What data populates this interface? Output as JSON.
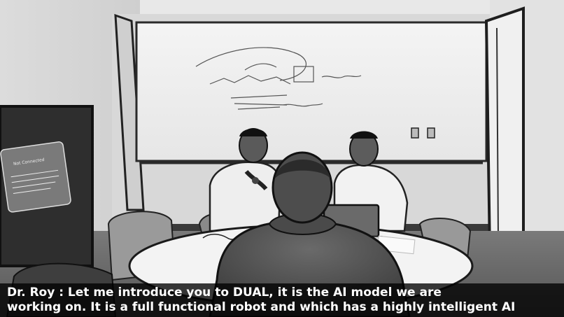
{
  "caption": {
    "line1": "Dr. Roy : Let me introduce you to DUAL, it is the AI model we are",
    "line2": "working on. It is a full functional robot and which has a highly intelligent AI"
  },
  "tv_screen": {
    "title": "Not Connected",
    "body": "Ensure the display is connected and the source is selected."
  },
  "colors": {
    "caption_background": "#000000",
    "caption_text": "#ffffff"
  }
}
